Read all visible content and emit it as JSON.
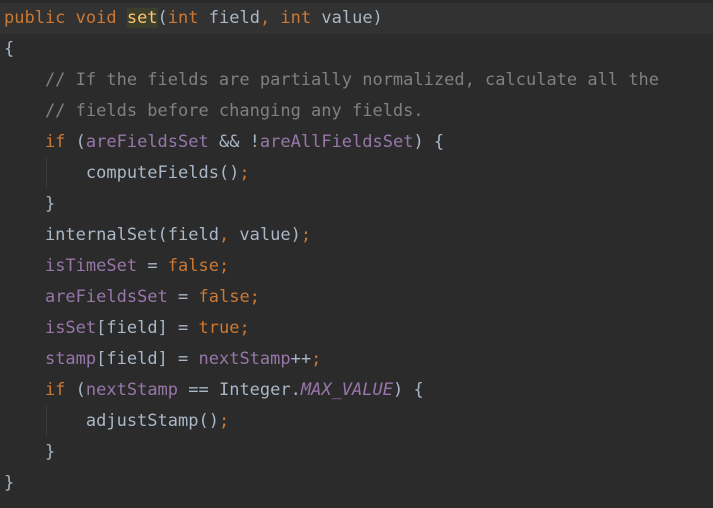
{
  "code": {
    "language": "java",
    "lines": [
      [
        {
          "t": "kw",
          "s": "public void "
        },
        {
          "t": "method-decl",
          "s": "set"
        },
        {
          "t": "plain",
          "s": "("
        },
        {
          "t": "kw",
          "s": "int "
        },
        {
          "t": "plain",
          "s": "field"
        },
        {
          "t": "punct",
          "s": ", "
        },
        {
          "t": "kw",
          "s": "int "
        },
        {
          "t": "plain",
          "s": "value)"
        }
      ],
      [
        {
          "t": "plain",
          "s": "{"
        }
      ],
      [
        {
          "t": "comment",
          "s": "    // If the fields are partially normalized, calculate all the"
        }
      ],
      [
        {
          "t": "comment",
          "s": "    // fields before changing any fields."
        }
      ],
      [
        {
          "t": "kw",
          "s": "    if "
        },
        {
          "t": "plain",
          "s": "("
        },
        {
          "t": "field",
          "s": "areFieldsSet"
        },
        {
          "t": "plain",
          "s": " && !"
        },
        {
          "t": "field",
          "s": "areAllFieldsSet"
        },
        {
          "t": "plain",
          "s": ") {"
        }
      ],
      [
        {
          "t": "plain",
          "s": "        computeFields()"
        },
        {
          "t": "punct",
          "s": ";"
        }
      ],
      [
        {
          "t": "plain",
          "s": "    }"
        }
      ],
      [
        {
          "t": "plain",
          "s": "    internalSet(field"
        },
        {
          "t": "punct",
          "s": ", "
        },
        {
          "t": "plain",
          "s": "value)"
        },
        {
          "t": "punct",
          "s": ";"
        }
      ],
      [
        {
          "t": "plain",
          "s": "    "
        },
        {
          "t": "field",
          "s": "isTimeSet"
        },
        {
          "t": "plain",
          "s": " = "
        },
        {
          "t": "kw",
          "s": "false;"
        }
      ],
      [
        {
          "t": "plain",
          "s": "    "
        },
        {
          "t": "field",
          "s": "areFieldsSet"
        },
        {
          "t": "plain",
          "s": " = "
        },
        {
          "t": "kw",
          "s": "false;"
        }
      ],
      [
        {
          "t": "plain",
          "s": "    "
        },
        {
          "t": "field",
          "s": "isSet"
        },
        {
          "t": "plain",
          "s": "[field] = "
        },
        {
          "t": "kw",
          "s": "true;"
        }
      ],
      [
        {
          "t": "plain",
          "s": "    "
        },
        {
          "t": "field",
          "s": "stamp"
        },
        {
          "t": "plain",
          "s": "[field] = "
        },
        {
          "t": "field",
          "s": "nextStamp"
        },
        {
          "t": "plain",
          "s": "++"
        },
        {
          "t": "punct",
          "s": ";"
        }
      ],
      [
        {
          "t": "kw",
          "s": "    if "
        },
        {
          "t": "plain",
          "s": "("
        },
        {
          "t": "field",
          "s": "nextStamp"
        },
        {
          "t": "plain",
          "s": " == Integer."
        },
        {
          "t": "static",
          "s": "MAX_VALUE"
        },
        {
          "t": "plain",
          "s": ") {"
        }
      ],
      [
        {
          "t": "plain",
          "s": "        adjustStamp()"
        },
        {
          "t": "punct",
          "s": ";"
        }
      ],
      [
        {
          "t": "plain",
          "s": "    }"
        }
      ],
      [
        {
          "t": "plain",
          "s": "}"
        }
      ]
    ]
  },
  "colors": {
    "background": "#2b2b2b",
    "keyword": "#cc7832",
    "comment": "#808080",
    "field": "#9876aa",
    "method_declaration": "#ffc66d",
    "plain": "#a9b7c6"
  }
}
